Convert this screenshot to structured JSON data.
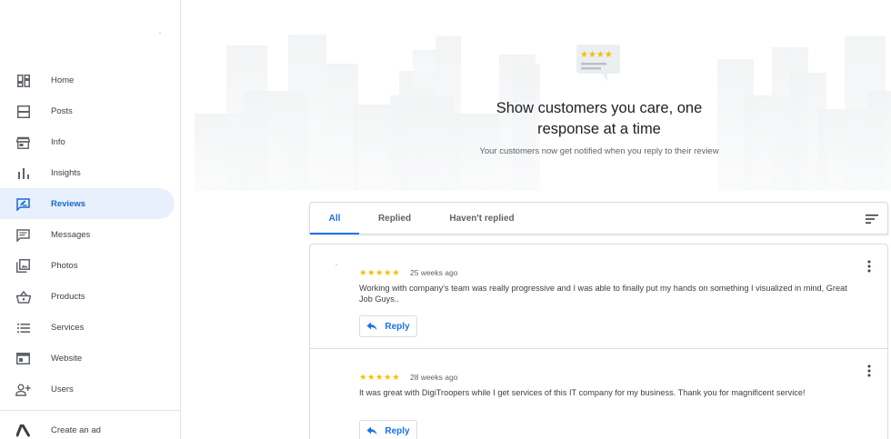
{
  "sidebar": {
    "items": [
      {
        "label": "Home",
        "icon": "dashboard-icon"
      },
      {
        "label": "Posts",
        "icon": "posts-icon"
      },
      {
        "label": "Info",
        "icon": "storefront-icon"
      },
      {
        "label": "Insights",
        "icon": "bar-chart-icon"
      },
      {
        "label": "Reviews",
        "icon": "reviews-icon",
        "active": true
      },
      {
        "label": "Messages",
        "icon": "message-icon"
      },
      {
        "label": "Photos",
        "icon": "photo-icon"
      },
      {
        "label": "Products",
        "icon": "basket-icon"
      },
      {
        "label": "Services",
        "icon": "list-icon"
      },
      {
        "label": "Website",
        "icon": "web-icon"
      },
      {
        "label": "Users",
        "icon": "add-user-icon"
      }
    ],
    "footer": {
      "label": "Create an ad",
      "icon": "google-ads-icon"
    }
  },
  "hero": {
    "title_line1": "Show customers you care, one",
    "title_line2": "response at a time",
    "subtitle": "Your customers now get notified when you reply to their review"
  },
  "tabs": [
    {
      "label": "All",
      "active": true
    },
    {
      "label": "Replied"
    },
    {
      "label": "Haven't replied"
    }
  ],
  "reviews": [
    {
      "stars": "★★★★★",
      "rating": 5,
      "time": "25 weeks ago",
      "text": "Working with company's team was really progressive and I was able to finally put my hands on something I visualized in mind, Great Job Guys..",
      "reply_label": "Reply"
    },
    {
      "stars": "★★★★★",
      "rating": 5,
      "time": "28 weeks ago",
      "text": "It was great with DigiTroopers while I get services of this IT company for my business. Thank you for magnificent service!",
      "reply_label": "Reply"
    }
  ],
  "colors": {
    "accent": "#1a73e8",
    "active_bg": "#e8f0fe",
    "star": "#fbbc04"
  }
}
